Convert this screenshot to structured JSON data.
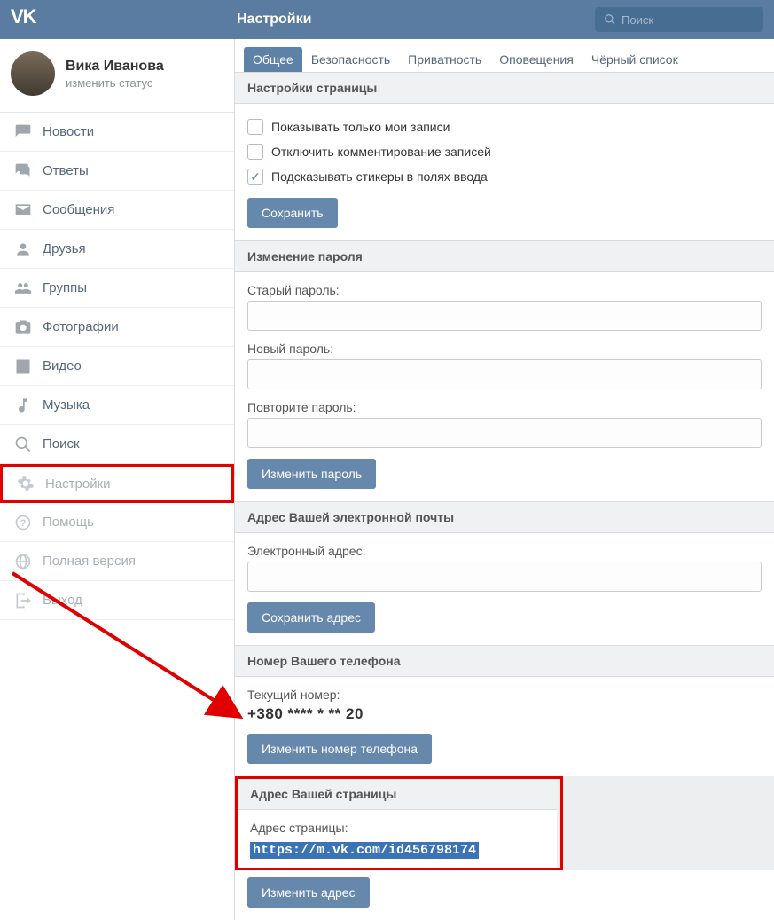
{
  "topbar": {
    "title": "Настройки",
    "search_placeholder": "Поиск"
  },
  "profile": {
    "name": "Вика Иванова",
    "status": "изменить статус"
  },
  "nav": {
    "news": "Новости",
    "replies": "Ответы",
    "messages": "Сообщения",
    "friends": "Друзья",
    "groups": "Группы",
    "photos": "Фотографии",
    "videos": "Видео",
    "music": "Музыка",
    "search": "Поиск",
    "settings": "Настройки",
    "help": "Помощь",
    "full_version": "Полная версия",
    "logout": "Выход"
  },
  "tabs": {
    "general": "Общее",
    "security": "Безопасность",
    "privacy": "Приватность",
    "notifications": "Оповещения",
    "blacklist": "Чёрный список"
  },
  "page_settings": {
    "header": "Настройки страницы",
    "only_my_posts": "Показывать только мои записи",
    "only_my_posts_checked": false,
    "disable_comments": "Отключить комментирование записей",
    "disable_comments_checked": false,
    "stickers_hint": "Подсказывать стикеры в полях ввода",
    "stickers_hint_checked": true,
    "save_btn": "Сохранить"
  },
  "password": {
    "header": "Изменение пароля",
    "old": "Старый пароль:",
    "new": "Новый пароль:",
    "repeat": "Повторите пароль:",
    "btn": "Изменить пароль"
  },
  "email": {
    "header": "Адрес Вашей электронной почты",
    "label": "Электронный адрес:",
    "btn": "Сохранить адрес"
  },
  "phone": {
    "header": "Номер Вашего телефона",
    "label": "Текущий номер:",
    "value": "+380 **** * ** 20",
    "btn": "Изменить номер телефона"
  },
  "page_url": {
    "header": "Адрес Вашей страницы",
    "label": "Адрес страницы:",
    "value": "https://m.vk.com/id456798174",
    "btn": "Изменить адрес"
  }
}
